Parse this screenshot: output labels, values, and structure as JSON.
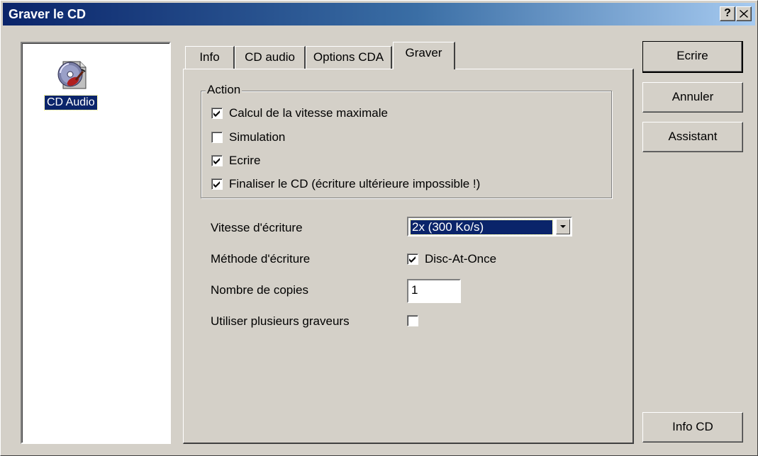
{
  "window": {
    "title": "Graver le CD",
    "help_button": "?",
    "close_button": "✕"
  },
  "list": {
    "items": [
      {
        "label": "CD Audio",
        "icon": "cd-audio-icon",
        "selected": true
      }
    ]
  },
  "tabs": [
    {
      "label": "Info",
      "active": false
    },
    {
      "label": "CD audio",
      "active": false
    },
    {
      "label": "Options CDA",
      "active": false
    },
    {
      "label": "Graver",
      "active": true
    }
  ],
  "action_group": {
    "legend": "Action",
    "options": [
      {
        "label": "Calcul de la vitesse maximale",
        "checked": true
      },
      {
        "label": "Simulation",
        "checked": false
      },
      {
        "label": "Ecrire",
        "checked": true
      },
      {
        "label": "Finaliser le CD (écriture ultérieure impossible !)",
        "checked": true
      }
    ]
  },
  "form": {
    "speed_label": "Vitesse d'écriture",
    "speed_value": "2x (300 Ko/s)",
    "method_label": "Méthode d'écriture",
    "method_option": "Disc-At-Once",
    "method_checked": true,
    "copies_label": "Nombre de copies",
    "copies_value": "1",
    "multi_label": "Utiliser plusieurs graveurs",
    "multi_checked": false
  },
  "buttons": {
    "write": "Ecrire",
    "cancel": "Annuler",
    "wizard": "Assistant",
    "cd_info": "Info CD"
  },
  "colors": {
    "face": "#d4d0c8",
    "title_start": "#0a246a",
    "title_end": "#a6caf0",
    "selection": "#0a246a"
  }
}
